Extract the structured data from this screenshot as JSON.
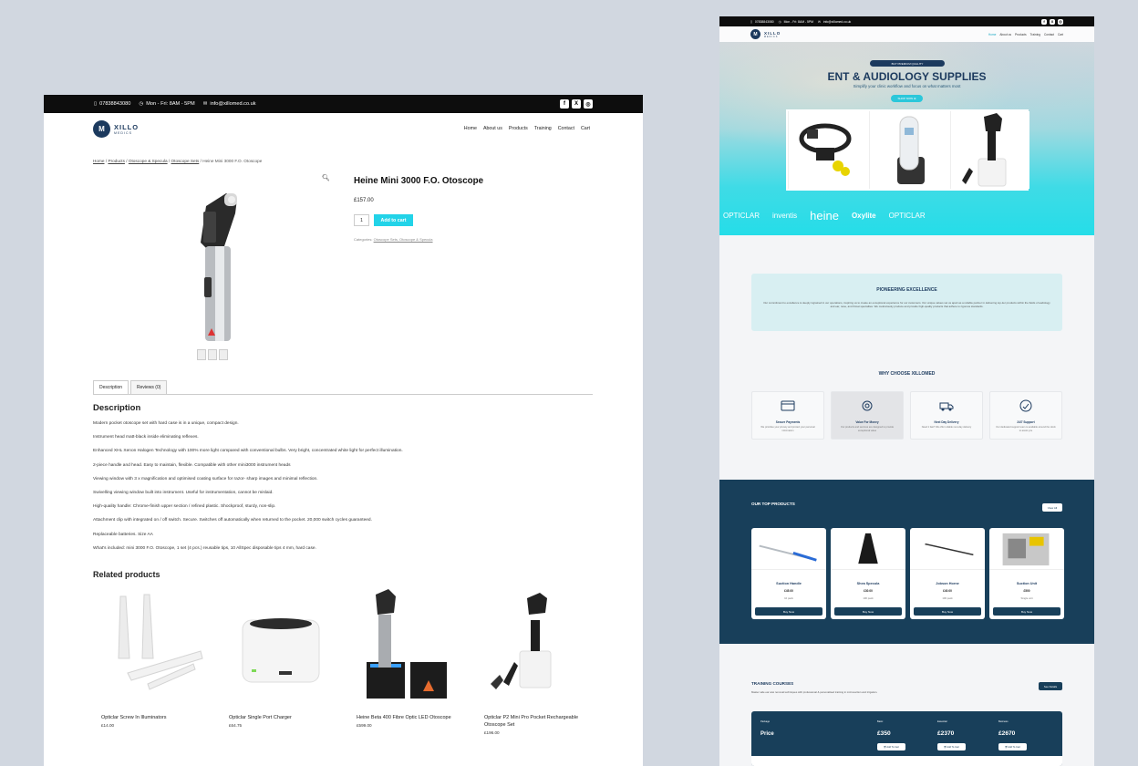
{
  "product_page": {
    "topbar": {
      "phone": "07838843080",
      "hours": "Mon - Fri: 8AM - 5PM",
      "email": "info@xillomed.co.uk",
      "social": [
        "f",
        "X",
        "◎"
      ]
    },
    "logo": {
      "name": "XILLO",
      "sub": "MEDICS"
    },
    "menu": [
      "Home",
      "About us",
      "Products",
      "Training",
      "Contact",
      "Cart"
    ],
    "breadcrumb": [
      "Home",
      "Products",
      "Otoscope & Specula",
      "Otoscope Sets",
      "Heine Mini 3000 F.O. Otoscope"
    ],
    "product": {
      "title": "Heine Mini 3000 F.O. Otoscope",
      "price": "£157.00",
      "qty": "1",
      "add_label": "Add to cart",
      "cat_label": "Categories:",
      "cats": "Otoscope Sets, Otoscope & Specula"
    },
    "tabs": [
      "Description",
      "Reviews (0)"
    ],
    "description_title": "Description",
    "description": [
      "Modern pocket otoscope set with hard case is in a unique, compact design.",
      "Instrument head matt-black inside eliminating reflexes.",
      "Enhanced XHL Xenon Halogen Technology with 100% more light compared with conventional bulbs. Very bright, concentrated white light for perfect illumination.",
      "2-piece handle and head. Easy to maintain, flexible. Compatible with other mini3000 instrument heads",
      "Viewing window with 3 x magnification and optimised coating surface for razor- sharp images and minimal reflection.",
      "Swivelling viewing window built into instrument. Useful for instrumentation, cannot be mislaid.",
      "High-quality handle: Chrome-finish upper section / refined plastic. Shockproof, sturdy, non-slip.",
      "Attachment clip with integrated on / off switch. Secure. Switches off automatically when returned to the pocket. 20,000 switch cycles guaranteed.",
      "Replaceable batteries. Size AA",
      "What's included: mini 3000 F.O. Otoscope, 1 set (4 pcs.) reusable tips, 10 AllSpec disposable tips 4 mm, hard case."
    ],
    "related_title": "Related products",
    "related": [
      {
        "name": "Opticlar Screw In Illuminators",
        "price": "£14.00"
      },
      {
        "name": "Opticlar Single Port Charger",
        "price": "£64.75"
      },
      {
        "name": "Heine Beta 400 Fibre Optic LED Otoscope",
        "price": "£599.00"
      },
      {
        "name": "Opticlar P2 Mini Pro Pocket Rechargeable Otoscope Set",
        "price": "£196.00"
      }
    ]
  },
  "home_page": {
    "topbar": {
      "phone": "07838843080",
      "hours": "Mon - Fri: 8AM - 5PM",
      "email": "info@xillomed.co.uk"
    },
    "hero": {
      "pill": "BUY PREMIUM QUALITY",
      "title": "ENT & AUDIOLOGY SUPPLIES",
      "sub": "Simplify your clinic workflow and focus on what matters most",
      "btn": "SHOP NOW ⊕"
    },
    "brands": [
      "OPTICLAR",
      "inventis",
      "heine",
      "Oxylite",
      "OPTICLAR"
    ],
    "pioneering": {
      "title": "PIONEERING EXCELLENCE",
      "text": "Our commitment to excellence is deeply ingrained in our operations, inspiring us to create an exceptional experience for our customers. Our unique values set us apart as a reliable partner in delivering top-tier products within the fields of audiology and ear, nose, and throat specialties. We meticulously produce and provide high-quality products that adhere to rigorous standards."
    },
    "why_title": "WHY CHOOSE XILLOMED",
    "features": [
      {
        "title": "Secure Payments",
        "text": "We prioritise your privacy and protect your personal information"
      },
      {
        "title": "Value For Money",
        "text": "Our products and services are designed to provide exceptional value"
      },
      {
        "title": "Next Day Delivery",
        "text": "Need it fast? We offer reliable next-day delivery"
      },
      {
        "title": "24/7 Support",
        "text": "Our dedicated support team is available around the clock to assist you"
      }
    ],
    "top_products": {
      "title": "OUR TOP PRODUCTS",
      "view_all": "View All",
      "buy": "Buy Now",
      "items": [
        {
          "name": "Suction Handle",
          "price": "£45.00",
          "unit": "10 pack"
        },
        {
          "name": "Shea Specula",
          "price": "£30.00",
          "unit": "100 pack"
        },
        {
          "name": "Jobson Horne",
          "price": "£40.00",
          "unit": "100 pack"
        },
        {
          "name": "Suction Unit",
          "price": "£500",
          "unit": "Single unit"
        }
      ]
    },
    "training": {
      "title": "TRAINING COURSES",
      "sub": "Master safe ear wax removal techniques with professional & personalised training in microsuction and irrigation.",
      "see_details": "See Details",
      "package_label": "Package",
      "price_label": "Price",
      "add": "Add To Cart",
      "tiers": [
        {
          "name": "Basic",
          "price": "£350"
        },
        {
          "name": "Essential",
          "price": "£2370"
        },
        {
          "name": "Business",
          "price": "£2670"
        }
      ]
    }
  }
}
